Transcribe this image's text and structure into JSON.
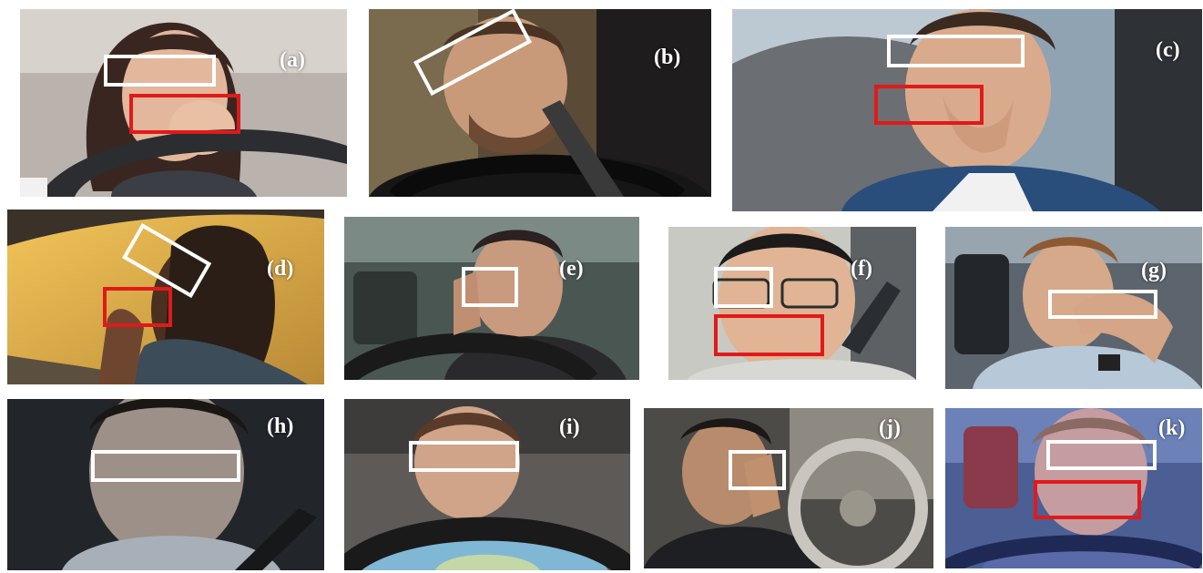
{
  "panels": [
    {
      "id": "a",
      "label": "(a)",
      "scene": "woman yawning while driving, hand over mouth",
      "boxes": [
        "eye",
        "mouth"
      ]
    },
    {
      "id": "b",
      "label": "(b)",
      "scene": "man with head down, eyes closed at wheel",
      "boxes": [
        "eye"
      ]
    },
    {
      "id": "c",
      "label": "(c)",
      "scene": "man yawning in car, hand over mouth",
      "boxes": [
        "eye",
        "mouth"
      ]
    },
    {
      "id": "d",
      "label": "(d)",
      "scene": "man tilting head back yawning by window",
      "boxes": [
        "eye",
        "mouth"
      ]
    },
    {
      "id": "e",
      "label": "(e)",
      "scene": "man rubbing eye while driving",
      "boxes": [
        "eye"
      ]
    },
    {
      "id": "f",
      "label": "(f)",
      "scene": "man with glasses yawning",
      "boxes": [
        "eye",
        "mouth"
      ]
    },
    {
      "id": "g",
      "label": "(g)",
      "scene": "man rubbing eyes in car",
      "boxes": [
        "eye"
      ]
    },
    {
      "id": "h",
      "label": "(h)",
      "scene": "man with drooping eyelids",
      "boxes": [
        "eye"
      ]
    },
    {
      "id": "i",
      "label": "(i)",
      "scene": "woman with eyes closed at steering wheel",
      "boxes": [
        "eye"
      ]
    },
    {
      "id": "j",
      "label": "(j)",
      "scene": "man leaning on hand in car",
      "boxes": [
        "eye"
      ]
    },
    {
      "id": "k",
      "label": "(k)",
      "scene": "woman yawning with hand over mouth",
      "boxes": [
        "eye",
        "mouth"
      ]
    }
  ],
  "colors": {
    "eye_box": "#ffffff",
    "mouth_box": "#e01a1a"
  }
}
